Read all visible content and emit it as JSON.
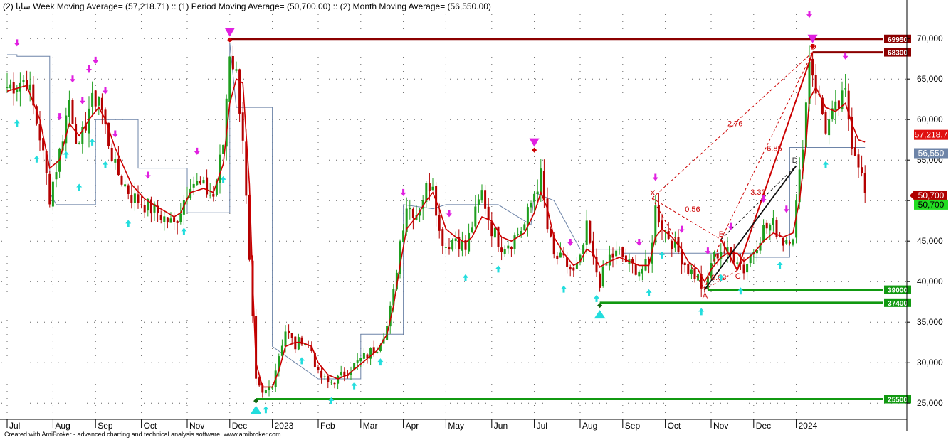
{
  "header": {
    "symbol": "سايا",
    "text": "(2) Week Moving Average= (57,218.71) :: (1) Period Moving Average= (50,700.00) :: (2) Month Moving Average= (56,550.00)"
  },
  "footer": "Created with AmiBroker - advanced charting and technical analysis software. www.amibroker.com",
  "colors": {
    "candle_up": "#1e9e1e",
    "candle_down": "#b40000",
    "week_ma": "#cc0000",
    "month_ma": "#6d84a8",
    "resistance": "#8b0000",
    "support": "#119911",
    "sell_arrow": "#e020e0",
    "buy_arrow": "#22dddd"
  },
  "chart_data": {
    "type": "candlestick",
    "title": "",
    "ylim": [
      23000,
      73000
    ],
    "y_ticks": [
      25000,
      30000,
      35000,
      40000,
      45000,
      50000,
      55000,
      60000,
      65000,
      70000
    ],
    "y_tick_labels": [
      "25,000",
      "30,000",
      "35,000",
      "40,000",
      "45,000",
      "50,000",
      "55,000",
      "60,000",
      "65,000",
      "70,000"
    ],
    "x_labels": [
      "Jul",
      "Aug",
      "Sep",
      "Oct",
      "Nov",
      "Dec",
      "2023",
      "Feb",
      "Mar",
      "Apr",
      "May",
      "Jun",
      "Jul",
      "Aug",
      "Sep",
      "Oct",
      "Nov",
      "Dec",
      "2024"
    ],
    "x_label_index": [
      0,
      14,
      27,
      41,
      55,
      68,
      81,
      95,
      108,
      121,
      134,
      148,
      161,
      175,
      188,
      201,
      215,
      228,
      241
    ],
    "price_path": [
      [
        0,
        64000
      ],
      [
        6,
        65000
      ],
      [
        10,
        58000
      ],
      [
        13,
        50500
      ],
      [
        16,
        56000
      ],
      [
        19,
        62500
      ],
      [
        22,
        56000
      ],
      [
        25,
        61500
      ],
      [
        28,
        63000
      ],
      [
        30,
        59000
      ],
      [
        33,
        54000
      ],
      [
        38,
        50500
      ],
      [
        42,
        49500
      ],
      [
        46,
        48500
      ],
      [
        49,
        47500
      ],
      [
        51,
        47000
      ],
      [
        53,
        49000
      ],
      [
        56,
        52500
      ],
      [
        60,
        51500
      ],
      [
        63,
        50500
      ],
      [
        66,
        57000
      ],
      [
        68,
        68500
      ],
      [
        70,
        65500
      ],
      [
        72,
        58000
      ],
      [
        74,
        42000
      ],
      [
        75,
        35000
      ],
      [
        76,
        27500
      ],
      [
        78,
        26000
      ],
      [
        81,
        27500
      ],
      [
        83,
        31000
      ],
      [
        85,
        34000
      ],
      [
        88,
        32000
      ],
      [
        90,
        33000
      ],
      [
        93,
        31500
      ],
      [
        95,
        28500
      ],
      [
        98,
        27500
      ],
      [
        101,
        28000
      ],
      [
        104,
        29000
      ],
      [
        107,
        30000
      ],
      [
        110,
        31000
      ],
      [
        113,
        32000
      ],
      [
        116,
        34500
      ],
      [
        118,
        38500
      ],
      [
        120,
        45000
      ],
      [
        122,
        49500
      ],
      [
        125,
        48500
      ],
      [
        128,
        51500
      ],
      [
        130,
        52500
      ],
      [
        132,
        46000
      ],
      [
        134,
        44500
      ],
      [
        137,
        45500
      ],
      [
        140,
        44000
      ],
      [
        142,
        47000
      ],
      [
        145,
        51000
      ],
      [
        148,
        46500
      ],
      [
        151,
        44500
      ],
      [
        154,
        45000
      ],
      [
        158,
        47000
      ],
      [
        161,
        51000
      ],
      [
        163,
        53000
      ],
      [
        165,
        46500
      ],
      [
        167,
        43000
      ],
      [
        170,
        42500
      ],
      [
        173,
        41000
      ],
      [
        175,
        42500
      ],
      [
        177,
        46500
      ],
      [
        179,
        42500
      ],
      [
        181,
        40000
      ],
      [
        184,
        43000
      ],
      [
        187,
        43500
      ],
      [
        190,
        42000
      ],
      [
        193,
        41500
      ],
      [
        196,
        42000
      ],
      [
        198,
        49000
      ],
      [
        200,
        47000
      ],
      [
        203,
        45000
      ],
      [
        206,
        43000
      ],
      [
        208,
        41500
      ],
      [
        211,
        40500
      ],
      [
        213,
        38500
      ],
      [
        215,
        42500
      ],
      [
        218,
        44000
      ],
      [
        220,
        43500
      ],
      [
        223,
        43000
      ],
      [
        225,
        41500
      ],
      [
        228,
        44000
      ],
      [
        231,
        46500
      ],
      [
        234,
        47000
      ],
      [
        237,
        45000
      ],
      [
        240,
        46000
      ],
      [
        242,
        53000
      ],
      [
        244,
        62000
      ],
      [
        245,
        67800
      ],
      [
        247,
        64000
      ],
      [
        250,
        59000
      ],
      [
        253,
        61000
      ],
      [
        256,
        63000
      ],
      [
        258,
        57500
      ],
      [
        260,
        55000
      ],
      [
        262,
        50700
      ]
    ],
    "series": [
      {
        "name": "Week Moving Average",
        "last": 57218.71,
        "label": "57,218.7",
        "points": [
          [
            0,
            63500
          ],
          [
            6,
            64200
          ],
          [
            10,
            60000
          ],
          [
            13,
            54000
          ],
          [
            16,
            55000
          ],
          [
            19,
            59500
          ],
          [
            22,
            58000
          ],
          [
            25,
            60000
          ],
          [
            28,
            61500
          ],
          [
            30,
            60000
          ],
          [
            33,
            56500
          ],
          [
            38,
            52000
          ],
          [
            42,
            50200
          ],
          [
            46,
            49200
          ],
          [
            49,
            48500
          ],
          [
            51,
            48000
          ],
          [
            53,
            48500
          ],
          [
            56,
            51000
          ],
          [
            60,
            51500
          ],
          [
            63,
            51000
          ],
          [
            66,
            54500
          ],
          [
            68,
            62000
          ],
          [
            70,
            65000
          ],
          [
            72,
            64500
          ],
          [
            74,
            52000
          ],
          [
            75,
            40000
          ],
          [
            76,
            30000
          ],
          [
            78,
            27000
          ],
          [
            81,
            27000
          ],
          [
            83,
            29000
          ],
          [
            85,
            32000
          ],
          [
            88,
            32500
          ],
          [
            90,
            32500
          ],
          [
            93,
            32000
          ],
          [
            95,
            30000
          ],
          [
            98,
            28500
          ],
          [
            101,
            28000
          ],
          [
            104,
            28500
          ],
          [
            107,
            29500
          ],
          [
            110,
            30500
          ],
          [
            113,
            31500
          ],
          [
            116,
            33500
          ],
          [
            118,
            37000
          ],
          [
            120,
            42000
          ],
          [
            122,
            46500
          ],
          [
            125,
            48000
          ],
          [
            128,
            50000
          ],
          [
            130,
            51000
          ],
          [
            132,
            49000
          ],
          [
            134,
            46500
          ],
          [
            137,
            45500
          ],
          [
            140,
            44800
          ],
          [
            142,
            45500
          ],
          [
            145,
            48000
          ],
          [
            148,
            47500
          ],
          [
            151,
            45500
          ],
          [
            154,
            45000
          ],
          [
            158,
            46000
          ],
          [
            161,
            48500
          ],
          [
            163,
            51000
          ],
          [
            165,
            49000
          ],
          [
            167,
            45500
          ],
          [
            170,
            43500
          ],
          [
            173,
            42000
          ],
          [
            175,
            42500
          ],
          [
            177,
            44000
          ],
          [
            179,
            43500
          ],
          [
            181,
            41800
          ],
          [
            184,
            42500
          ],
          [
            187,
            43000
          ],
          [
            190,
            42500
          ],
          [
            193,
            42000
          ],
          [
            196,
            42000
          ],
          [
            198,
            45500
          ],
          [
            200,
            46500
          ],
          [
            203,
            45500
          ],
          [
            206,
            44000
          ],
          [
            208,
            42500
          ],
          [
            211,
            41500
          ],
          [
            213,
            40000
          ],
          [
            215,
            41500
          ],
          [
            218,
            43000
          ],
          [
            220,
            43500
          ],
          [
            223,
            43500
          ],
          [
            225,
            42500
          ],
          [
            228,
            43500
          ],
          [
            231,
            45000
          ],
          [
            234,
            46000
          ],
          [
            237,
            45500
          ],
          [
            240,
            46000
          ],
          [
            242,
            50000
          ],
          [
            244,
            57000
          ],
          [
            245,
            62500
          ],
          [
            247,
            64000
          ],
          [
            250,
            61500
          ],
          [
            253,
            61000
          ],
          [
            256,
            62000
          ],
          [
            258,
            59500
          ],
          [
            260,
            57500
          ],
          [
            262,
            57218
          ]
        ]
      },
      {
        "name": "Month Moving Average",
        "last": 56550,
        "label": "56,550",
        "points": [
          [
            0,
            68000
          ],
          [
            3,
            68000
          ],
          [
            3,
            67800
          ],
          [
            13,
            67800
          ],
          [
            13,
            51000
          ],
          [
            15,
            49500
          ],
          [
            27,
            49500
          ],
          [
            27,
            60000
          ],
          [
            40,
            60000
          ],
          [
            40,
            54000
          ],
          [
            55,
            54000
          ],
          [
            55,
            48500
          ],
          [
            68,
            48500
          ],
          [
            68,
            69500
          ],
          [
            70,
            61500
          ],
          [
            81,
            61500
          ],
          [
            81,
            32000
          ],
          [
            95,
            28000
          ],
          [
            108,
            28000
          ],
          [
            108,
            33500
          ],
          [
            121,
            33500
          ],
          [
            121,
            49500
          ],
          [
            130,
            49000
          ],
          [
            134,
            49500
          ],
          [
            150,
            49500
          ],
          [
            160,
            47000
          ],
          [
            161,
            51000
          ],
          [
            167,
            50000
          ],
          [
            175,
            44000
          ],
          [
            188,
            44000
          ],
          [
            188,
            43500
          ],
          [
            228,
            43500
          ],
          [
            228,
            43000
          ],
          [
            239,
            43000
          ],
          [
            239,
            56550
          ],
          [
            249,
            56550
          ],
          [
            262,
            56550
          ]
        ]
      }
    ],
    "period_ma": {
      "name": "Period Moving Average",
      "value": 50700,
      "label": "50,700"
    },
    "levels": [
      {
        "value": 69950,
        "label": "69950",
        "kind": "resistance",
        "from": 68
      },
      {
        "value": 68300,
        "label": "68300",
        "kind": "resistance",
        "from": 246
      },
      {
        "value": 39000,
        "label": "39000",
        "kind": "support",
        "from": 214
      },
      {
        "value": 37400,
        "label": "37400",
        "kind": "support",
        "from": 181
      },
      {
        "value": 25500,
        "label": "25500",
        "kind": "support",
        "from": 76
      }
    ],
    "sell_signals": [
      3,
      16,
      20,
      23,
      25,
      27,
      30,
      33,
      43,
      58,
      121,
      135,
      172,
      193,
      198,
      206,
      214,
      221,
      231,
      238,
      245,
      256
    ],
    "buy_signals": [
      3,
      9,
      18,
      22,
      26,
      30,
      37,
      54,
      66,
      79,
      90,
      99,
      106,
      114,
      140,
      150,
      170,
      180,
      196,
      200,
      212,
      218,
      224,
      236,
      250
    ],
    "big_markers": [
      {
        "x": 68,
        "type": "sell",
        "value": 70400
      },
      {
        "x": 161,
        "type": "sell",
        "value": 56800
      },
      {
        "x": 246,
        "type": "sell",
        "value": 69600
      },
      {
        "x": 76,
        "type": "buy",
        "value": 24700
      },
      {
        "x": 181,
        "type": "buy",
        "value": 36500
      }
    ],
    "harmonic": {
      "points": [
        {
          "label": "X",
          "x": 197,
          "value": 50300
        },
        {
          "label": "A",
          "x": 213,
          "value": 39000
        },
        {
          "label": "B",
          "x": 218,
          "value": 45200
        },
        {
          "label": "C",
          "x": 223,
          "value": 41400
        },
        {
          "label": "D",
          "x": 246,
          "value": 68300
        }
      ],
      "d2": {
        "label": "D",
        "x": 241,
        "value": 54300
      },
      "ratios": [
        {
          "text": "0.56",
          "x": 207,
          "value": 48600
        },
        {
          "text": "0.68",
          "x": 215,
          "value": 40200
        },
        {
          "text": "3.33",
          "x": 227,
          "value": 50700
        },
        {
          "text": "6.85",
          "x": 232,
          "value": 56100
        },
        {
          "text": "2.76",
          "x": 220,
          "value": 59200
        }
      ]
    }
  }
}
